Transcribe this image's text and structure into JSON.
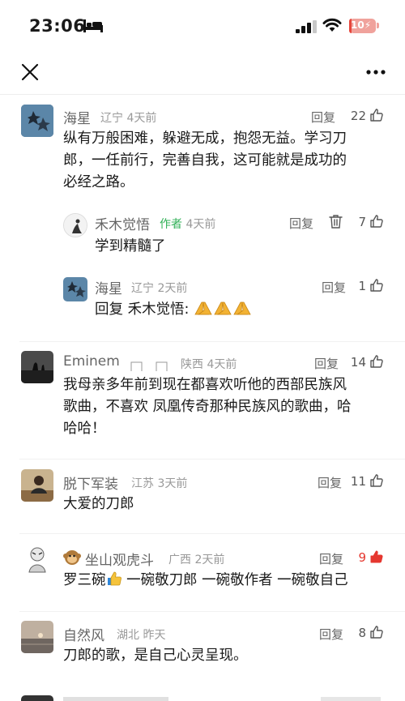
{
  "status_bar": {
    "time": "23:06",
    "battery": "10",
    "battery_level": 0.1
  },
  "comments": [
    {
      "username": "海星",
      "location": "辽宁",
      "time": "4天前",
      "reply": "回复",
      "likes": "22",
      "text": [
        "纵有万般困难，躲避无成，抱怨无益。学习刀",
        "郎，一任前行，完善自我，这可能就是成功的",
        "必经之路。"
      ],
      "replies": [
        {
          "username": "禾木觉悟",
          "tag": "作者",
          "time": "4天前",
          "reply": "回复",
          "likes": "7",
          "text": "学到精髓了"
        },
        {
          "username": "海星",
          "location": "辽宁",
          "time": "2天前",
          "reply": "回复",
          "likes": "1",
          "text": "回复 禾木觉悟: "
        }
      ]
    },
    {
      "username": "Eminem",
      "location": "陕西",
      "time": "4天前",
      "reply": "回复",
      "likes": "14",
      "text": [
        "我母亲多年前到现在都喜欢听他的西部民族风",
        "歌曲，不喜欢 凤凰传奇那种民族风的歌曲，哈",
        "哈哈！"
      ]
    },
    {
      "username": "脱下军装",
      "location": "江苏",
      "time": "3天前",
      "reply": "回复",
      "likes": "11",
      "text": [
        "大爱的刀郎"
      ]
    },
    {
      "username": "坐山观虎斗",
      "location": "广西",
      "time": "2天前",
      "reply": "回复",
      "likes": "9",
      "liked": true,
      "text_parts": [
        "罗三碗",
        " 一碗敬刀郎 一碗敬作者 一碗敬自己"
      ]
    },
    {
      "username": "自然风",
      "location": "湖北",
      "time": "昨天",
      "reply": "回复",
      "likes": "8",
      "text": [
        "刀郎的歌，是自己心灵呈现。"
      ]
    }
  ],
  "colors": {
    "accent_like": "#e5372f",
    "author_tag": "#31b057",
    "meta": "#999999"
  }
}
